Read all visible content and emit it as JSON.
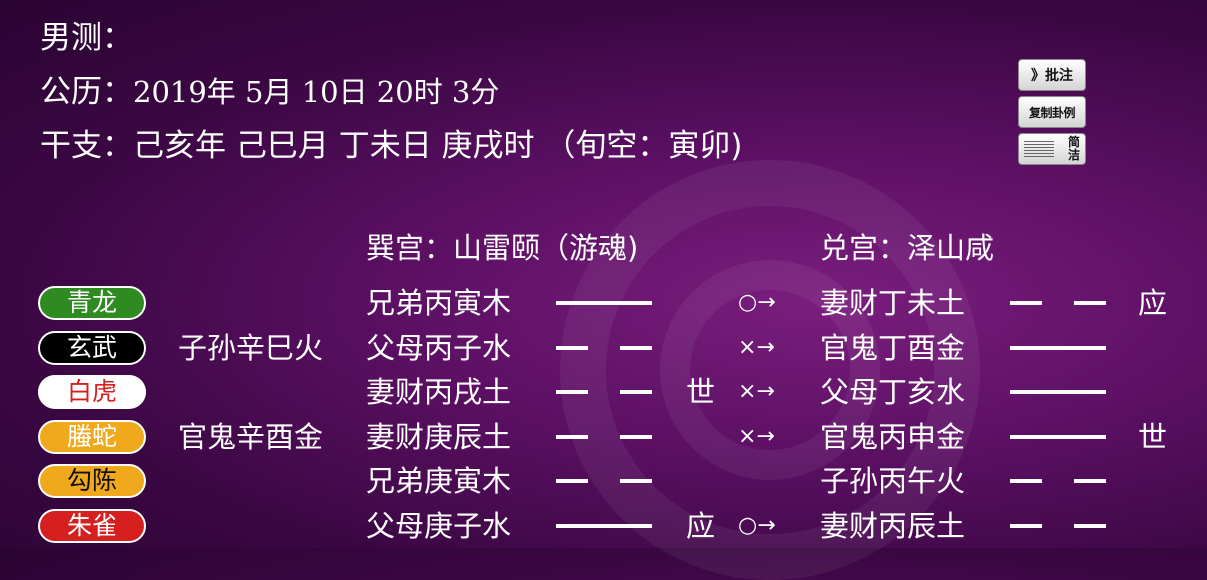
{
  "header": {
    "gender_line": "男测：",
    "solar_label": "公历：",
    "solar_date": "2019年 5月 10日 20时 3分",
    "ganzhi_label": "干支：",
    "ganzhi_value": "己亥年 己巳月 丁未日 庚戌时 （旬空：寅卯)"
  },
  "buttons": {
    "pizhu": "》批注",
    "copy": "复制卦例",
    "jianjie_top": "简",
    "jianjie_bottom": "洁"
  },
  "hexagram": {
    "main_title": "巽宫：山雷颐（游魂)",
    "changed_title": "兑宫：泽山咸"
  },
  "colors": {
    "qinglong": "#2e8b1f",
    "xuanwu": "#000000",
    "baihu": "#ffffff",
    "tengshe": "#f0a81c",
    "gouchen": "#f0a81c",
    "zhuque": "#d61f1f"
  },
  "lines": [
    {
      "spirit": "青龙",
      "hidden": "",
      "main": "兄弟丙寅木",
      "main_yang": true,
      "mark1": "",
      "move": "○→",
      "changed": "妻财丁未土",
      "changed_yang": false,
      "mark2": "应"
    },
    {
      "spirit": "玄武",
      "hidden": "子孙辛巳火",
      "main": "父母丙子水",
      "main_yang": false,
      "mark1": "",
      "move": "×→",
      "changed": "官鬼丁酉金",
      "changed_yang": true,
      "mark2": ""
    },
    {
      "spirit": "白虎",
      "hidden": "",
      "main": "妻财丙戌土",
      "main_yang": false,
      "mark1": "世",
      "move": "×→",
      "changed": "父母丁亥水",
      "changed_yang": true,
      "mark2": ""
    },
    {
      "spirit": "螣蛇",
      "hidden": "官鬼辛酉金",
      "main": "妻财庚辰土",
      "main_yang": false,
      "mark1": "",
      "move": "×→",
      "changed": "官鬼丙申金",
      "changed_yang": true,
      "mark2": "世"
    },
    {
      "spirit": "勾陈",
      "hidden": "",
      "main": "兄弟庚寅木",
      "main_yang": false,
      "mark1": "",
      "move": "",
      "changed": "子孙丙午火",
      "changed_yang": false,
      "mark2": ""
    },
    {
      "spirit": "朱雀",
      "hidden": "",
      "main": "父母庚子水",
      "main_yang": true,
      "mark1": "应",
      "move": "○→",
      "changed": "妻财丙辰土",
      "changed_yang": false,
      "mark2": ""
    }
  ]
}
